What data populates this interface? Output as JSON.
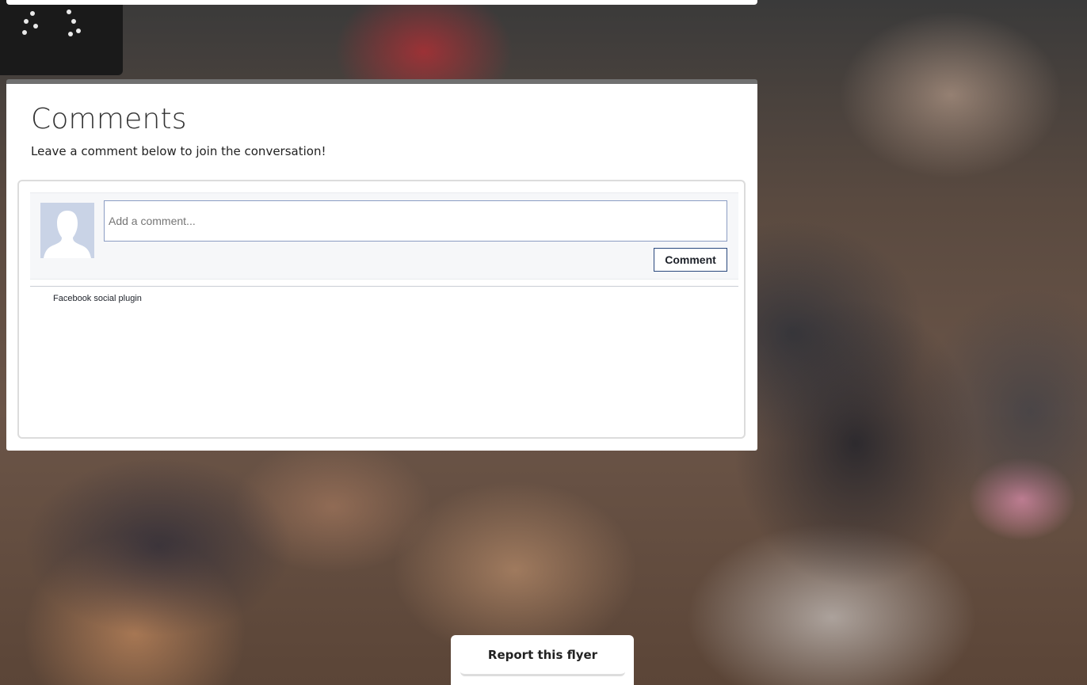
{
  "comments": {
    "title": "Comments",
    "subtitle": "Leave a comment below to join the conversation!"
  },
  "facebook_plugin": {
    "input_placeholder": "Add a comment...",
    "comment_button": "Comment",
    "plugin_label": "Facebook social plugin",
    "avatar_icon": "default-profile-silhouette-icon",
    "colors": {
      "avatar_bg": "#c9d3e6",
      "input_border": "#8b9dc3",
      "button_border": "#29487d"
    }
  },
  "report_button": {
    "label": "Report this flyer"
  },
  "background": {
    "icon": "crowd-photo-background"
  }
}
